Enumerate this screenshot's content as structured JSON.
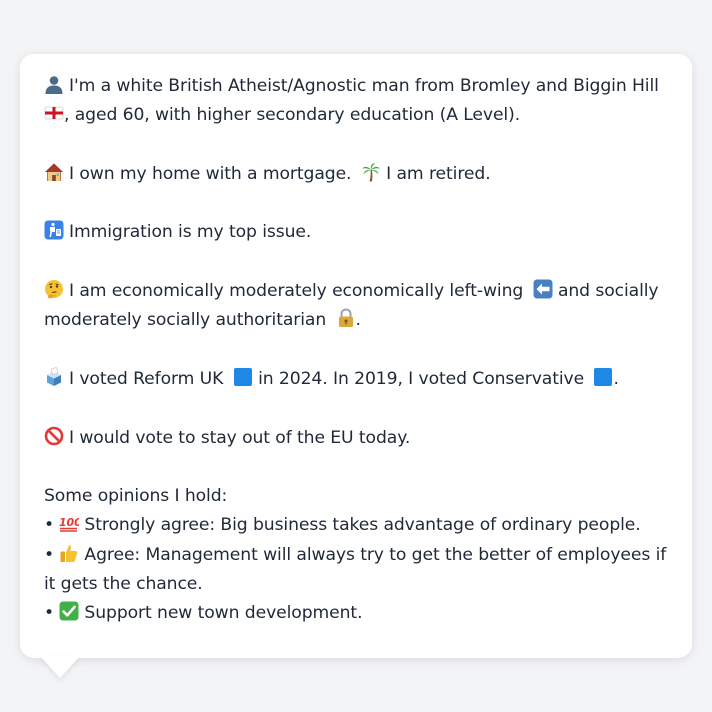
{
  "colors": {
    "background": "#f3f4f6",
    "card": "#ffffff",
    "text": "#1f2937",
    "reform_blue": "#1e88e5",
    "conservative_blue": "#1e88e5"
  },
  "profile": {
    "identity": {
      "icon": "bust-in-silhouette-icon",
      "text": "I'm a white British Atheist/Agnostic man from Bromley and Biggin Hill",
      "flag_icon": "england-flag-icon",
      "text_after": ", aged 60, with higher secondary education (A Level)."
    },
    "home": {
      "icon": "house-icon",
      "text": "I own my home with a mortgage.",
      "retired_icon": "palm-tree-icon",
      "retired_text": "I am retired."
    },
    "top_issue": {
      "icon": "passport-control-icon",
      "text": "Immigration is my top issue."
    },
    "ideology": {
      "icon": "thinking-face-icon",
      "text_1": "I am economically moderately economically left-wing",
      "left_icon": "left-arrow-icon",
      "text_2": "and socially moderately socially authoritarian",
      "lock_icon": "padlock-icon",
      "text_3": "."
    },
    "vote": {
      "icon": "ballot-box-icon",
      "text_1": "I voted Reform UK",
      "reform_icon": "blue-square-icon",
      "text_2": "in 2024. In 2019, I voted Conservative",
      "conservative_icon": "blue-square-icon",
      "text_3": "."
    },
    "eu": {
      "icon": "prohibited-icon",
      "text": "I would vote to stay out of the EU today."
    },
    "opinions": {
      "heading": "Some opinions I hold:",
      "bullet": "•",
      "items": [
        {
          "icon": "hundred-points-icon",
          "text": "Strongly agree: Big business takes advantage of ordinary people."
        },
        {
          "icon": "thumbs-up-icon",
          "text": "Agree: Management will always try to get the better of employees if it gets the chance."
        },
        {
          "icon": "check-mark-button-icon",
          "text": "Support new town development."
        }
      ]
    }
  }
}
